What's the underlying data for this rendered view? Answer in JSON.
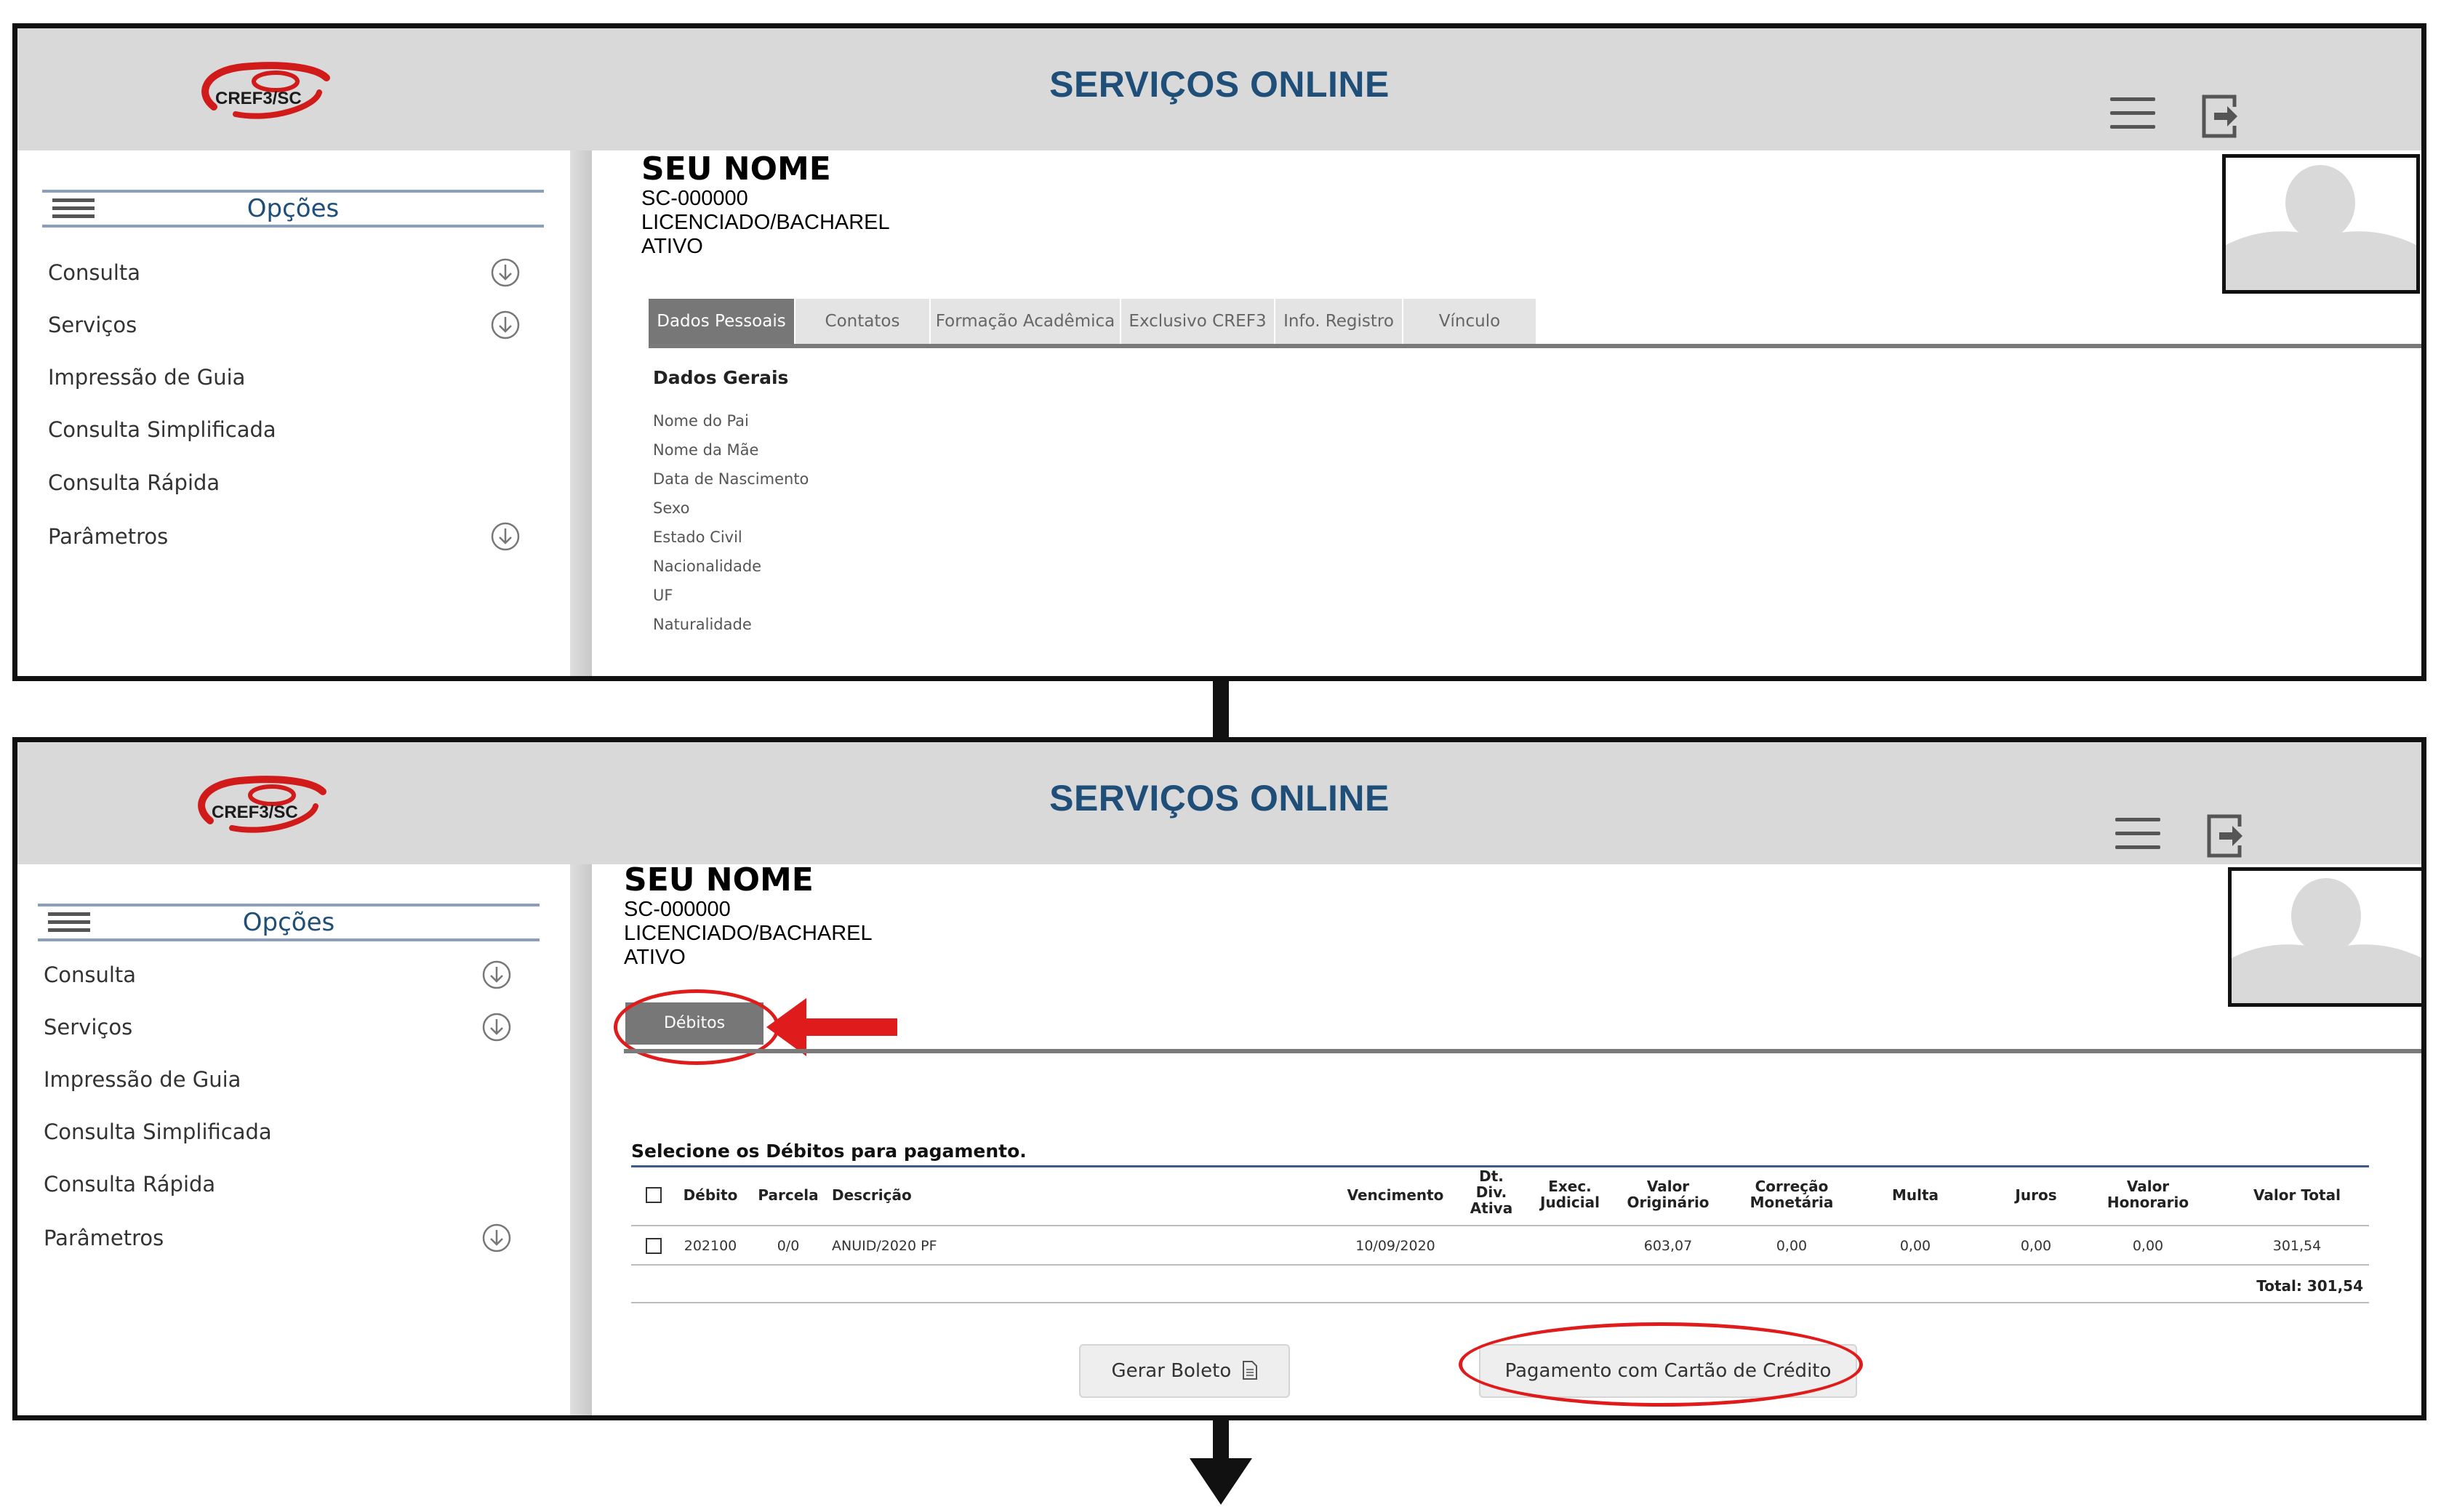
{
  "screens": [
    {
      "header": {
        "logo_text": "CREF3/SC",
        "title": "SERVIÇOS ONLINE"
      },
      "sidebar": {
        "options_label": "Opções",
        "items": [
          {
            "label": "Consulta",
            "expandable": true
          },
          {
            "label": "Serviços",
            "expandable": true
          },
          {
            "label": "Impressão de Guia",
            "expandable": false
          },
          {
            "label": "Consulta Simplificada",
            "expandable": false
          },
          {
            "label": "Consulta Rápida",
            "expandable": false
          },
          {
            "label": "Parâmetros",
            "expandable": true
          }
        ]
      },
      "profile": {
        "name": "SEU NOME",
        "registration": "SC-000000",
        "category": "LICENCIADO/BACHAREL",
        "status": "ATIVO"
      },
      "tabs": [
        "Dados Pessoais",
        "Contatos",
        "Formação Acadêmica",
        "Exclusivo CREF3",
        "Info. Registro",
        "Vínculo"
      ],
      "active_tab": "Dados Pessoais",
      "section_title": "Dados Gerais",
      "fields": [
        "Nome do Pai",
        "Nome da Mãe",
        "Data de Nascimento",
        "Sexo",
        "Estado Civil",
        "Nacionalidade",
        "UF",
        "Naturalidade"
      ]
    },
    {
      "header": {
        "logo_text": "CREF3/SC",
        "title": "SERVIÇOS ONLINE"
      },
      "sidebar": {
        "options_label": "Opções",
        "items": [
          {
            "label": "Consulta",
            "expandable": true
          },
          {
            "label": "Serviços",
            "expandable": true
          },
          {
            "label": "Impressão de Guia",
            "expandable": false
          },
          {
            "label": "Consulta Simplificada",
            "expandable": false
          },
          {
            "label": "Consulta Rápida",
            "expandable": false
          },
          {
            "label": "Parâmetros",
            "expandable": true
          }
        ]
      },
      "profile": {
        "name": "SEU NOME",
        "registration": "SC-000000",
        "category": "LICENCIADO/BACHAREL",
        "status": "ATIVO"
      },
      "tab": "Débitos",
      "instruction": "Selecione os Débitos para pagamento.",
      "table": {
        "headers": {
          "debito": "Débito",
          "parcela": "Parcela",
          "descricao": "Descrição",
          "vencimento": "Vencimento",
          "dt_div_ativa": [
            "Dt.",
            "Div.",
            "Ativa"
          ],
          "exec_judicial": [
            "Exec.",
            "Judicial"
          ],
          "valor_originario": [
            "Valor",
            "Originário"
          ],
          "correcao_monetaria": [
            "Correção",
            "Monetária"
          ],
          "multa": "Multa",
          "juros": "Juros",
          "valor_honorario": [
            "Valor",
            "Honorario"
          ],
          "valor_total": "Valor Total"
        },
        "rows": [
          {
            "debito": "202100",
            "parcela": "0/0",
            "descricao": "ANUID/2020 PF",
            "vencimento": "10/09/2020",
            "valor_originario": "603,07",
            "correcao_monetaria": "0,00",
            "multa": "0,00",
            "juros": "0,00",
            "valor_honorario": "0,00",
            "valor_total": "301,54"
          }
        ],
        "total": "Total: 301,54"
      },
      "buttons": {
        "boleto": "Gerar Boleto",
        "cartao": "Pagamento com Cartão de Crédito"
      },
      "colors": {
        "highlight": "#e01b1b",
        "title_blue": "#1f4e79"
      }
    }
  ]
}
